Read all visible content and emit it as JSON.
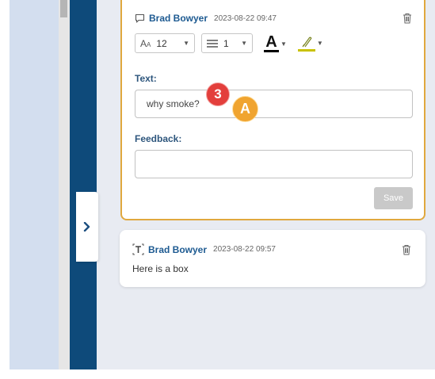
{
  "comments": [
    {
      "author": "Brad Bowyer",
      "timestamp": "2023-08-22 09:47",
      "type_icon": "speech-bubble-icon",
      "toolbar": {
        "font_size": "12",
        "line_width": "1",
        "font_color": "#000000",
        "highlight_color": "#c9c200"
      },
      "text_label": "Text:",
      "text_value": "why smoke?",
      "feedback_label": "Feedback:",
      "feedback_value": "",
      "save_label": "Save"
    },
    {
      "author": "Brad Bowyer",
      "timestamp": "2023-08-22 09:57",
      "type_icon": "text-box-icon",
      "body": "Here is a box"
    }
  ],
  "markers": {
    "red": "3",
    "orange": "A"
  },
  "colors": {
    "accent": "#e0a83e",
    "nav": "#0e4a7a",
    "author": "#1d5a91"
  }
}
